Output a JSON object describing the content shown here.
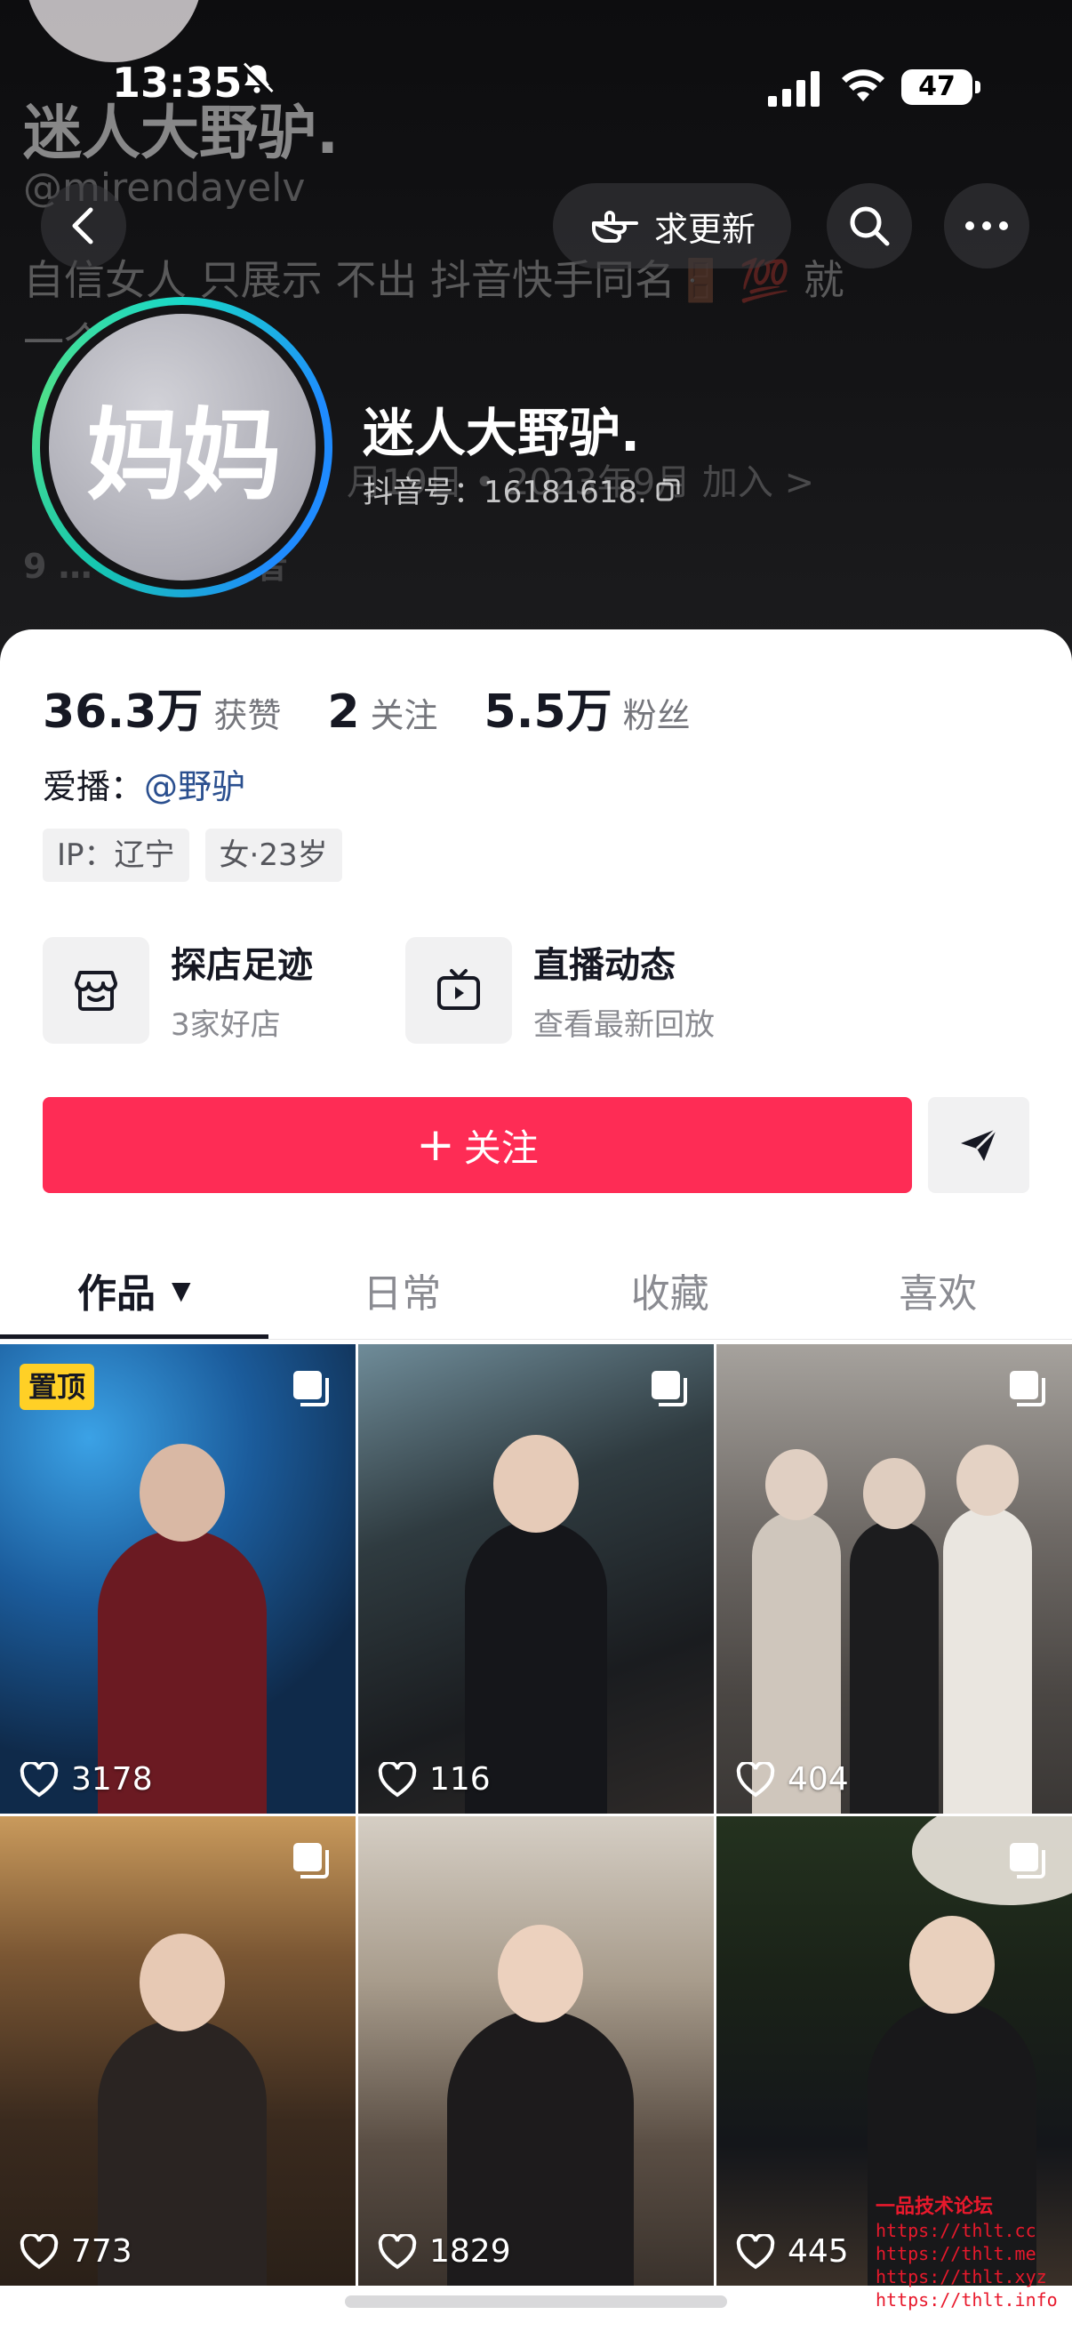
{
  "status_bar": {
    "time": "13:35",
    "battery": "47"
  },
  "background_overlay": {
    "name": "迷人大野驴.",
    "handle": "@mirendayelv",
    "bio": "自信女人 只展示 不出 抖音快手同名🚪 💯 就一个",
    "row": "月19日 • 2023年9月 加入 >",
    "stats": "9 … 623 关注者"
  },
  "nav": {
    "request_update_label": "求更新",
    "icons": [
      "back-arrow-icon",
      "pointing-hand-icon",
      "search-icon",
      "more-icon"
    ]
  },
  "profile": {
    "avatar_text": "妈妈",
    "name": "迷人大野驴.",
    "douyin_id": "抖音号：16181618."
  },
  "stats": [
    {
      "value": "36.3万",
      "label": "获赞"
    },
    {
      "value": "2",
      "label": "关注"
    },
    {
      "value": "5.5万",
      "label": "粉丝"
    }
  ],
  "love": {
    "label": "爱播：",
    "link": "@野驴"
  },
  "tags": [
    "IP：辽宁",
    "女·23岁"
  ],
  "features": [
    {
      "title": "探店足迹",
      "subtitle": "3家好店",
      "icon": "store-icon"
    },
    {
      "title": "直播动态",
      "subtitle": "查看最新回放",
      "icon": "tv-icon"
    }
  ],
  "actions": {
    "follow_label": "关注",
    "follow_prefix": "+",
    "share_icon": "send-icon"
  },
  "tabs": [
    {
      "label": "作品",
      "active": true
    },
    {
      "label": "日常",
      "active": false
    },
    {
      "label": "收藏",
      "active": false
    },
    {
      "label": "喜欢",
      "active": false
    }
  ],
  "videos": [
    {
      "likes": "3178",
      "pinned": true,
      "pinned_label": "置顶"
    },
    {
      "likes": "116",
      "pinned": false
    },
    {
      "likes": "404",
      "pinned": false
    },
    {
      "likes": "773",
      "pinned": false
    },
    {
      "likes": "1829",
      "pinned": false
    },
    {
      "likes": "445",
      "pinned": false
    }
  ],
  "watermark": [
    "一品技术论坛",
    "https://thlt.cc",
    "https://thlt.me",
    "https://thlt.xyz",
    "https://thlt.info"
  ],
  "colors": {
    "accent": "#fe2c55",
    "link": "#2a4f8f",
    "pin_badge": "#ffd026"
  }
}
